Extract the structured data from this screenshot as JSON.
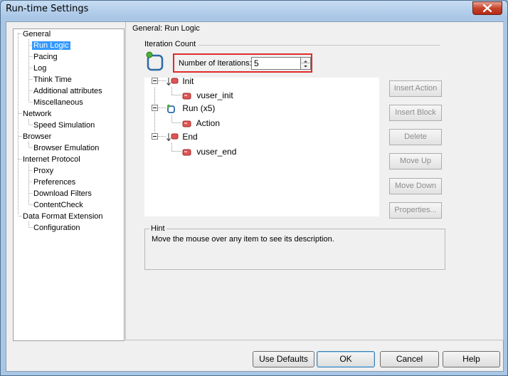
{
  "window": {
    "title": "Run-time Settings"
  },
  "tree": [
    {
      "label": "General",
      "level": 0,
      "selected": false
    },
    {
      "label": "Run Logic",
      "level": 1,
      "selected": true
    },
    {
      "label": "Pacing",
      "level": 1,
      "selected": false
    },
    {
      "label": "Log",
      "level": 1,
      "selected": false
    },
    {
      "label": "Think Time",
      "level": 1,
      "selected": false
    },
    {
      "label": "Additional attributes",
      "level": 1,
      "selected": false
    },
    {
      "label": "Miscellaneous",
      "level": 1,
      "selected": false
    },
    {
      "label": "Network",
      "level": 0,
      "selected": false
    },
    {
      "label": "Speed Simulation",
      "level": 1,
      "selected": false
    },
    {
      "label": "Browser",
      "level": 0,
      "selected": false
    },
    {
      "label": "Browser Emulation",
      "level": 1,
      "selected": false
    },
    {
      "label": "Internet Protocol",
      "level": 0,
      "selected": false
    },
    {
      "label": "Proxy",
      "level": 1,
      "selected": false
    },
    {
      "label": "Preferences",
      "level": 1,
      "selected": false
    },
    {
      "label": "Download Filters",
      "level": 1,
      "selected": false
    },
    {
      "label": "ContentCheck",
      "level": 1,
      "selected": false
    },
    {
      "label": "Data Format Extension",
      "level": 0,
      "selected": false
    },
    {
      "label": "Configuration",
      "level": 1,
      "selected": false
    }
  ],
  "panel": {
    "header": "General: Run Logic",
    "iteration_count_label": "Iteration Count",
    "iterations_label": "Number of Iterations:",
    "iterations_value": "5"
  },
  "flow": [
    {
      "label": "Init",
      "level": 0,
      "icon": "block-arrow-icon"
    },
    {
      "label": "vuser_init",
      "level": 1,
      "icon": "action-icon"
    },
    {
      "label": "Run (x5)",
      "level": 0,
      "icon": "loop-icon"
    },
    {
      "label": "Action",
      "level": 1,
      "icon": "action-icon"
    },
    {
      "label": "End",
      "level": 0,
      "icon": "block-arrow-icon"
    },
    {
      "label": "vuser_end",
      "level": 1,
      "icon": "action-icon"
    }
  ],
  "side_buttons": {
    "insert_action": "Insert Action",
    "insert_block": "Insert Block",
    "delete": "Delete",
    "move_up": "Move Up",
    "move_down": "Move Down",
    "properties": "Properties..."
  },
  "hint": {
    "title": "Hint",
    "text": "Move the mouse over any item to see its description."
  },
  "bottom_buttons": {
    "use_defaults": "Use Defaults",
    "ok": "OK",
    "cancel": "Cancel",
    "help": "Help"
  },
  "colors": {
    "highlight_border": "#e02b2b",
    "selection": "#3399ff"
  }
}
